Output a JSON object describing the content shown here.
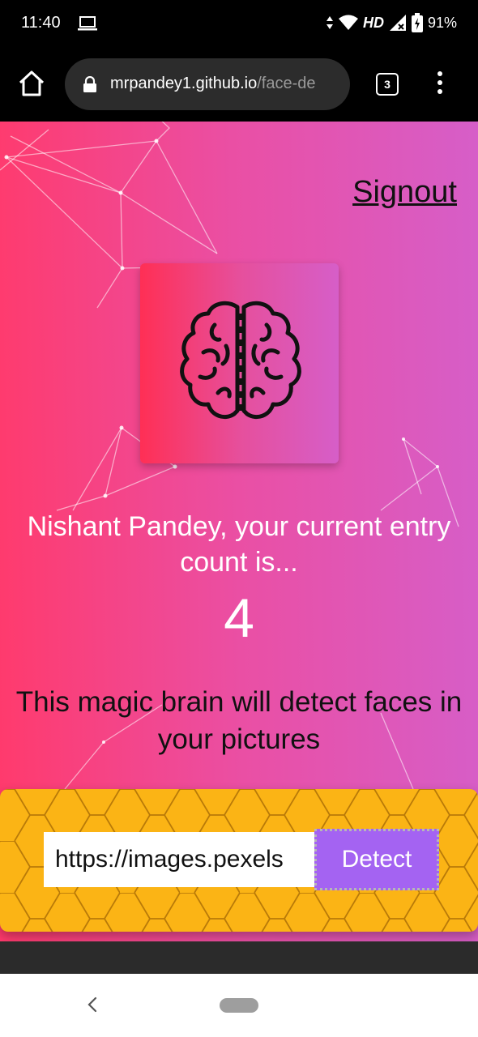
{
  "status_bar": {
    "time": "11:40",
    "network": "HD",
    "battery": "91%"
  },
  "browser": {
    "url_host": "mrpandey1.github.io",
    "url_path": "/face-de",
    "tab_count": "3"
  },
  "page": {
    "signout_label": "Signout",
    "greeting": "Nishant Pandey, your current entry count is...",
    "entry_count": "4",
    "tagline": "This magic brain will detect faces in your pictures",
    "image_url_value": "https://images.pexels",
    "detect_label": "Detect"
  },
  "colors": {
    "gradient_start": "#ff3a6c",
    "gradient_end": "#d65ec8",
    "form_bg": "#fbb415",
    "detect_button": "#a463f2"
  },
  "icons": [
    "laptop-icon",
    "wifi-icon",
    "signal-icon",
    "battery-icon",
    "home-icon",
    "lock-icon",
    "tabs-icon",
    "menu-icon",
    "brain-icon",
    "back-icon",
    "home-pill"
  ]
}
